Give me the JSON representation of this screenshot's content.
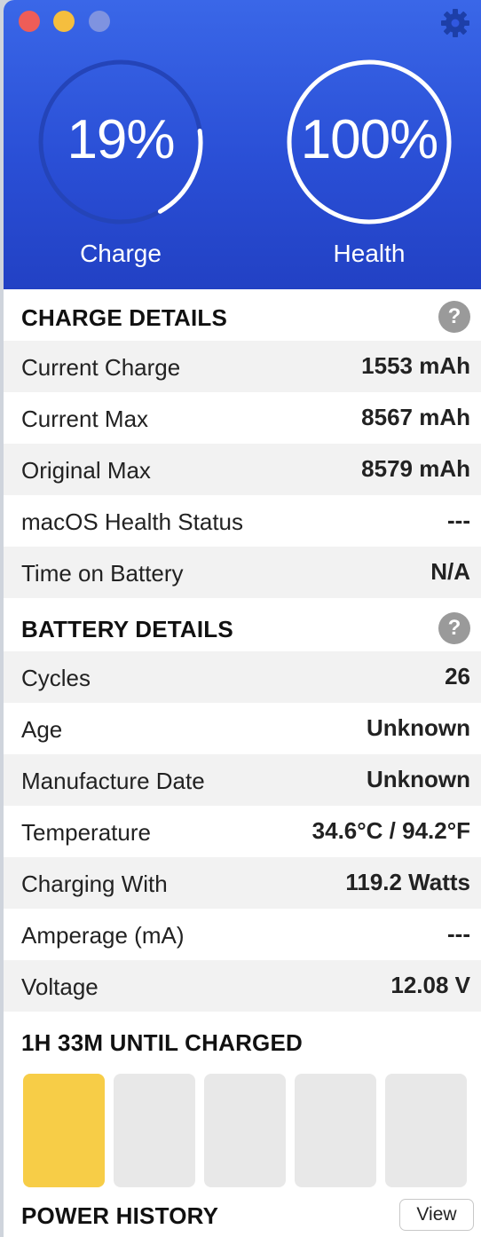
{
  "window": {
    "traffic_lights": [
      "close",
      "minimize",
      "zoom"
    ],
    "settings_icon": "gear-icon",
    "colors": {
      "header_top": "#3a67e8",
      "header_bottom": "#2241c4",
      "charging_bar": "#f7cd47",
      "empty_bar": "#e8e8e8"
    }
  },
  "gauges": {
    "charge": {
      "value": "19%",
      "label": "Charge",
      "level": 0.19
    },
    "health": {
      "value": "100%",
      "label": "Health",
      "level": 1.0
    }
  },
  "charge_details": {
    "title": "CHARGE DETAILS",
    "help": "?",
    "rows": [
      {
        "label": "Current Charge",
        "value": "1553 mAh"
      },
      {
        "label": "Current Max",
        "value": "8567 mAh"
      },
      {
        "label": "Original Max",
        "value": "8579 mAh"
      },
      {
        "label": "macOS Health Status",
        "value": "---"
      },
      {
        "label": "Time on Battery",
        "value": "N/A"
      }
    ]
  },
  "battery_details": {
    "title": "BATTERY DETAILS",
    "help": "?",
    "rows": [
      {
        "label": "Cycles",
        "value": "26"
      },
      {
        "label": "Age",
        "value": "Unknown"
      },
      {
        "label": "Manufacture Date",
        "value": "Unknown"
      },
      {
        "label": "Temperature",
        "value": "34.6°C / 94.2°F"
      },
      {
        "label": "Charging With",
        "value": "119.2 Watts"
      },
      {
        "label": "Amperage (mA)",
        "value": "---"
      },
      {
        "label": "Voltage",
        "value": "12.08 V"
      }
    ]
  },
  "charging": {
    "title": "1H 33M UNTIL CHARGED",
    "segments_total": 5,
    "segments_filled": 1
  },
  "power_history": {
    "title": "POWER HISTORY",
    "view_label": "View"
  }
}
